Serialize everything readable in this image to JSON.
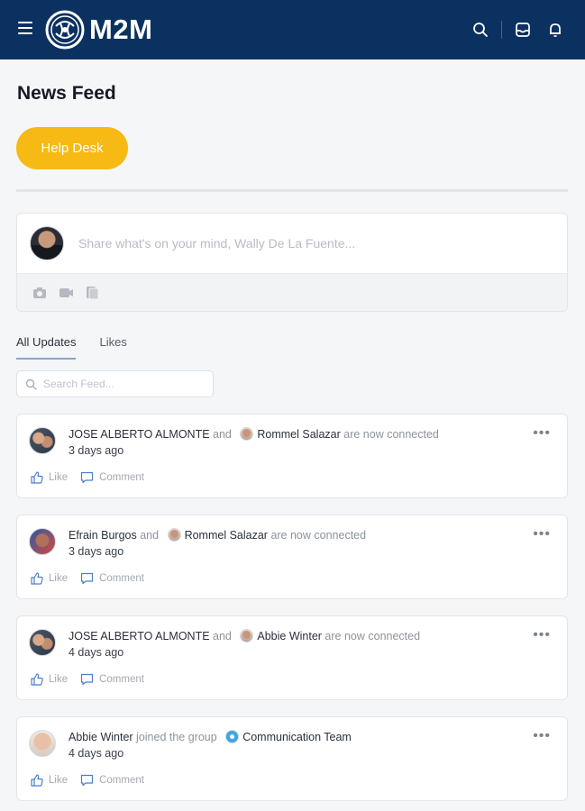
{
  "header": {
    "logo_text": "M2M",
    "bg_color": "#0b3160",
    "icons": [
      "menu-icon",
      "search-icon",
      "inbox-icon",
      "bell-icon"
    ]
  },
  "page": {
    "title": "News Feed",
    "help_button": "Help Desk",
    "accent_color": "#f7b913"
  },
  "composer": {
    "placeholder": "Share what's on your mind, Wally De La Fuente...",
    "tools": [
      "camera-icon",
      "video-icon",
      "document-icon"
    ]
  },
  "tabs": [
    {
      "label": "All Updates",
      "active": true
    },
    {
      "label": "Likes",
      "active": false
    }
  ],
  "search": {
    "placeholder": "Search Feed..."
  },
  "feed": [
    {
      "actor": "JOSE ALBERTO ALMONTE",
      "conj": "and",
      "target": "Rommel Salazar",
      "verb": "are now connected",
      "time": "3 days ago",
      "like": "Like",
      "comment": "Comment"
    },
    {
      "actor": "Efrain Burgos",
      "conj": "and",
      "target": "Rommel Salazar",
      "verb": "are now connected",
      "time": "3 days ago",
      "like": "Like",
      "comment": "Comment"
    },
    {
      "actor": "JOSE ALBERTO ALMONTE",
      "conj": "and",
      "target": "Abbie Winter",
      "verb": "are now connected",
      "time": "4 days ago",
      "like": "Like",
      "comment": "Comment"
    },
    {
      "actor": "Abbie Winter",
      "conj": "joined the group",
      "target": "Communication Team",
      "verb": "",
      "time": "4 days ago",
      "like": "Like",
      "comment": "Comment"
    }
  ]
}
